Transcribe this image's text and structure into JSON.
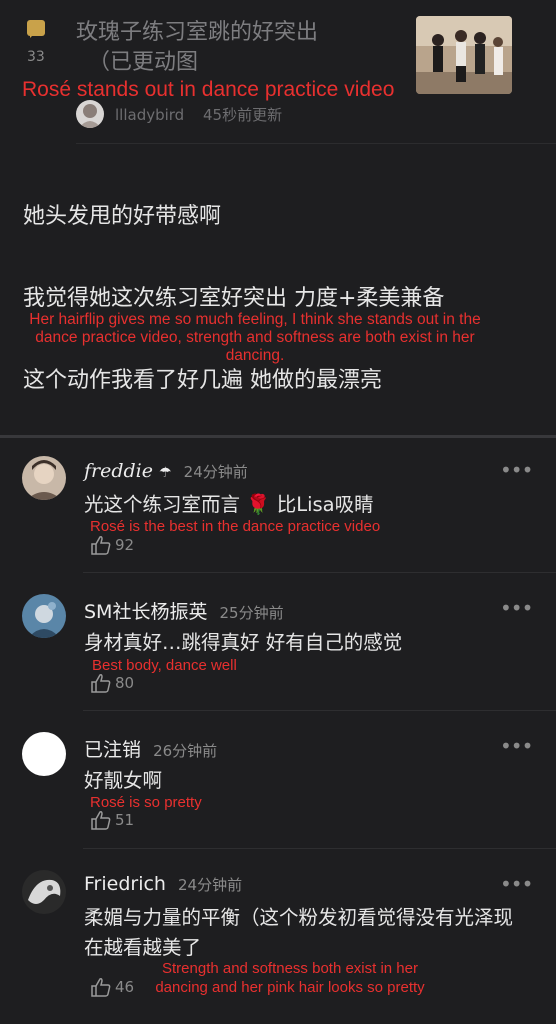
{
  "header": {
    "comment_count": "33",
    "title_line1": "玫瑰子练习室跳的好突出",
    "title_line2": "（已更动图",
    "translation": "Rosé stands out in dance practice video",
    "author": "llladybird",
    "updated": "45秒前更新"
  },
  "post": {
    "paragraph1": "她头发甩的好带感啊",
    "paragraph2": "我觉得她这次练习室好突出 力度+柔美兼备",
    "paragraph3": "这个动作我看了好几遍 她做的最漂亮",
    "translation": "Her hairflip gives me so much feeling, I think she stands out in the dance practice video, strength and softness are both exist in her dancing."
  },
  "comments": [
    {
      "name": "freddie",
      "name_suffix": "☂",
      "time": "24分钟前",
      "text_before": "光这个练习室而言",
      "emoji": "🌹",
      "text_after": "比Lisa吸睛",
      "translation": "Rosé is the best in the dance practice video",
      "likes": "92"
    },
    {
      "name": "SM社长杨振英",
      "time": "25分钟前",
      "text": "身材真好…跳得真好 好有自己的感觉",
      "translation": "Best body, dance well",
      "likes": "80"
    },
    {
      "name": "已注销",
      "time": "26分钟前",
      "text": "好靓女啊",
      "translation": "Rosé is so pretty",
      "likes": "51"
    },
    {
      "name": "Friedrich",
      "time": "24分钟前",
      "text": "柔媚与力量的平衡（这个粉发初看觉得没有光泽现在越看越美了",
      "translation": "Strength and softness both exist in her dancing and her pink hair looks so pretty",
      "likes": "46"
    }
  ],
  "ui": {
    "more_glyph": "•••"
  },
  "colors": {
    "translation": "#e8302f",
    "background": "#1e1e20",
    "bubble": "#c9a24a"
  }
}
